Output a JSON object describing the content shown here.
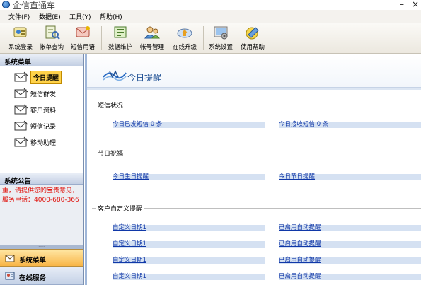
{
  "window": {
    "title": "企信直通车",
    "minimize_label": "–",
    "close_label": "×"
  },
  "menu": {
    "items": [
      {
        "label": "文件(F)"
      },
      {
        "label": "数据(E)"
      },
      {
        "label": "工具(Y)"
      },
      {
        "label": "帮助(H)"
      }
    ]
  },
  "toolbar": {
    "buttons": [
      {
        "label": "系统登录",
        "icon": "login-icon"
      },
      {
        "label": "帐单查询",
        "icon": "bill-query-icon"
      },
      {
        "label": "短信用语",
        "icon": "sms-phrases-icon"
      },
      {
        "label": "数据维护",
        "icon": "data-maintenance-icon"
      },
      {
        "label": "帐号管理",
        "icon": "account-management-icon"
      },
      {
        "label": "在线升级",
        "icon": "online-upgrade-icon"
      },
      {
        "label": "系统设置",
        "icon": "system-settings-icon"
      },
      {
        "label": "使用帮助",
        "icon": "help-icon"
      }
    ]
  },
  "sidebar": {
    "menu_header": "系统菜单",
    "items": [
      {
        "label": "今日提醒",
        "active": true
      },
      {
        "label": "短信群发"
      },
      {
        "label": "客户资料"
      },
      {
        "label": "短信记录"
      },
      {
        "label": "移动助理"
      }
    ],
    "notice_header": "系统公告",
    "notice_text": "重，请提供您的宝贵意见，服务电话：4000-680-366",
    "splitter_grip": "·····",
    "bottom_tabs": [
      {
        "label": "系统菜单",
        "active": true
      },
      {
        "label": "在线服务"
      }
    ]
  },
  "main": {
    "banner_title": "今日提醒",
    "sms_status": {
      "title": "短信状况",
      "sent_today": "今日已发短信 0 条",
      "received_today": "今日接收短信 0 条"
    },
    "holiday": {
      "title": "节日祝福",
      "birthday": "今日生日提醒",
      "festival": "今日节日提醒"
    },
    "custom": {
      "title": "客户自定义提醒",
      "rows": [
        {
          "date": "自定义日期1",
          "status": "已启用自动提醒"
        },
        {
          "date": "自定义日期1",
          "status": "已启用自动提醒"
        },
        {
          "date": "自定义日期1",
          "status": "已启用自动提醒"
        },
        {
          "date": "自定义日期1",
          "status": "已启用自动提醒"
        }
      ]
    }
  },
  "colors": {
    "link": "#1038a8",
    "field_bg": "#d5e1f2",
    "notice_text": "#e0100a",
    "active_tab": "#f8b547",
    "banner_text": "#1e4f94"
  }
}
